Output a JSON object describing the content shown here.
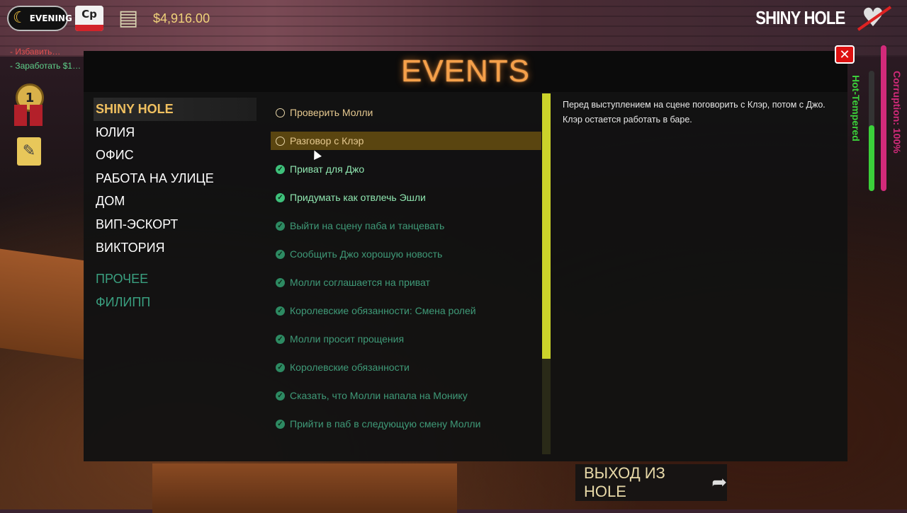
{
  "hud": {
    "time_of_day": "EVENING",
    "card_label": "Cp",
    "money": "$4,916.00",
    "quest_hints": [
      "- Избавить…",
      "- Заработать $1…"
    ],
    "medal_number": "1"
  },
  "location": {
    "name": "SHINY HOLE"
  },
  "meters": {
    "hot_tempered_label": "Hot-Tempered",
    "corruption_label": "Corruption: 100%",
    "hot_tempered_level": 0.55,
    "corruption_level": 1.0,
    "hot_tempered_color": "#3bd03a",
    "corruption_color": "#d22a7a"
  },
  "panel": {
    "title": "EVENTS",
    "categories": [
      {
        "label": "SHINY HOLE",
        "active": true
      },
      {
        "label": "ЮЛИЯ"
      },
      {
        "label": "ОФИС"
      },
      {
        "label": "РАБОТА НА УЛИЦЕ"
      },
      {
        "label": "ДОМ"
      },
      {
        "label": "ВИП-ЭСКОРТ"
      },
      {
        "label": "ВИКТОРИЯ"
      }
    ],
    "other_categories": [
      {
        "label": "ПРОЧЕЕ"
      },
      {
        "label": "ФИЛИПП"
      }
    ],
    "events": [
      {
        "label": "Проверить Молли",
        "status": "current"
      },
      {
        "label": "Разговор с Клэр",
        "status": "current",
        "selected": true
      },
      {
        "label": "Приват для Джо",
        "status": "done"
      },
      {
        "label": "Придумать как отвлечь Эшли",
        "status": "done"
      },
      {
        "label": "Выйти на сцену паба и танцевать",
        "status": "done-old"
      },
      {
        "label": "Сообщить Джо хорошую новость",
        "status": "done-old"
      },
      {
        "label": "Молли соглашается на приват",
        "status": "done-old"
      },
      {
        "label": "Королевские обязанности: Смена ролей",
        "status": "done-old"
      },
      {
        "label": "Молли просит прощения",
        "status": "done-old"
      },
      {
        "label": "Королевские обязанности",
        "status": "done-old"
      },
      {
        "label": "Сказать, что Молли напала на Монику",
        "status": "done-old"
      },
      {
        "label": "Прийти в паб в следующую смену Молли",
        "status": "done-old"
      }
    ],
    "description": "Перед выступлением на сцене поговорить с Клэр, потом с Джо. Клэр остается работать в баре.",
    "accent_color": "#f5a04a",
    "scrollbar_color": "#cbd32a"
  },
  "exit": {
    "label": "ВЫХОД ИЗ HOLE"
  }
}
